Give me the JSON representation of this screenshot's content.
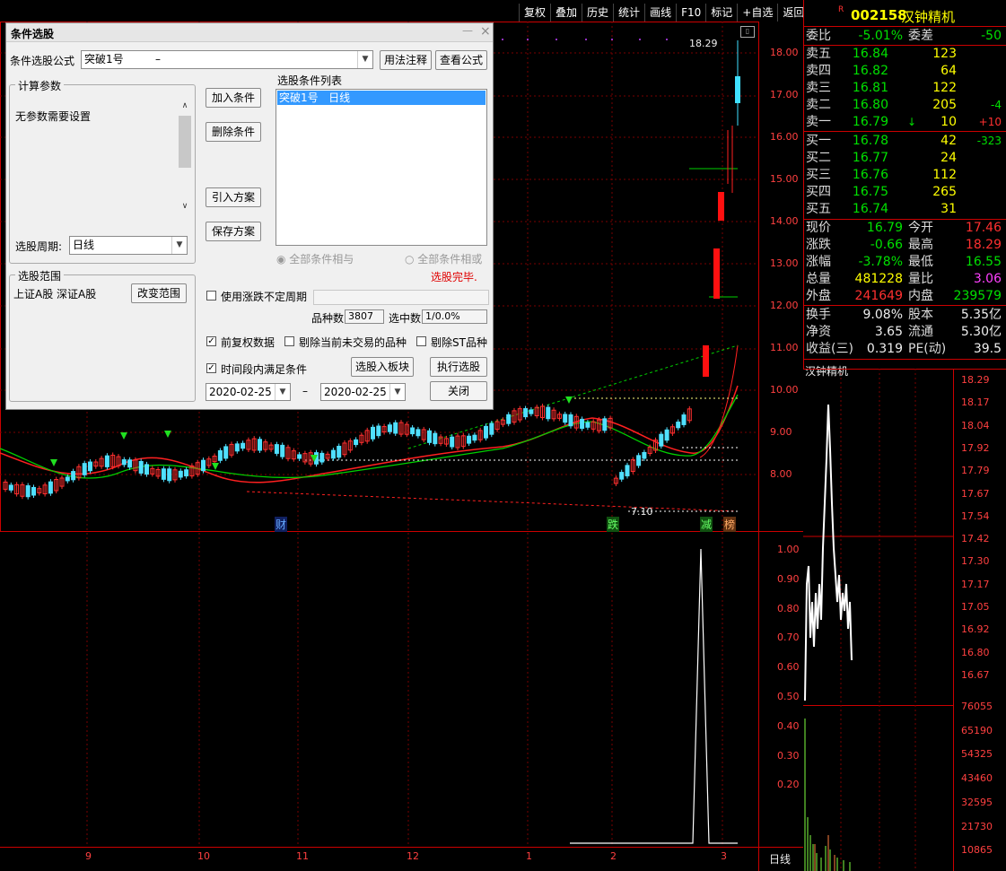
{
  "toolbar": [
    "复权",
    "叠加",
    "历史",
    "统计",
    "画线",
    "F10",
    "标记",
    "+自选",
    "返回"
  ],
  "stock": {
    "code": "002158",
    "name": "汉钟精机",
    "flag": "R"
  },
  "summary": {
    "weibi_label": "委比",
    "weibi": "-5.01%",
    "weicha_label": "委差",
    "weicha": "-50"
  },
  "asks": [
    {
      "label": "卖五",
      "price": "16.84",
      "vol": "123",
      "chg": ""
    },
    {
      "label": "卖四",
      "price": "16.82",
      "vol": "64",
      "chg": ""
    },
    {
      "label": "卖三",
      "price": "16.81",
      "vol": "122",
      "chg": ""
    },
    {
      "label": "卖二",
      "price": "16.80",
      "vol": "205",
      "chg": "-4"
    },
    {
      "label": "卖一",
      "price": "16.79",
      "vol": "10",
      "chg": "+10",
      "arrow": "↓"
    }
  ],
  "bids": [
    {
      "label": "买一",
      "price": "16.78",
      "vol": "42",
      "chg": "-323"
    },
    {
      "label": "买二",
      "price": "16.77",
      "vol": "24",
      "chg": ""
    },
    {
      "label": "买三",
      "price": "16.76",
      "vol": "112",
      "chg": ""
    },
    {
      "label": "买四",
      "price": "16.75",
      "vol": "265",
      "chg": ""
    },
    {
      "label": "买五",
      "price": "16.74",
      "vol": "31",
      "chg": ""
    }
  ],
  "stats1": [
    {
      "a": "现价",
      "b": "16.79",
      "c": "今开",
      "d": "17.46"
    },
    {
      "a": "涨跌",
      "b": "-0.66",
      "c": "最高",
      "d": "18.29"
    },
    {
      "a": "涨幅",
      "b": "-3.78%",
      "c": "最低",
      "d": "16.55"
    },
    {
      "a": "总量",
      "b": "481228",
      "c": "量比",
      "d": "3.06"
    },
    {
      "a": "外盘",
      "b": "241649",
      "c": "内盘",
      "d": "239579"
    }
  ],
  "stats2": [
    {
      "a": "换手",
      "b": "9.08%",
      "c": "股本",
      "d": "5.35亿"
    },
    {
      "a": "净资",
      "b": "3.65",
      "c": "流通",
      "d": "5.30亿"
    },
    {
      "a": "收益(三)",
      "b": "0.319",
      "c": "PE(动)",
      "d": "39.5"
    }
  ],
  "mini": {
    "title": "汉钟精机",
    "price_ticks": [
      "18.29",
      "18.17",
      "18.04",
      "17.92",
      "17.79",
      "17.67",
      "17.54",
      "17.42",
      "17.30",
      "17.17",
      "17.05",
      "16.92",
      "16.80",
      "16.67"
    ],
    "vol_ticks": [
      "76055",
      "65190",
      "54325",
      "43460",
      "32595",
      "21730",
      "10865"
    ],
    "period": "日线"
  },
  "main_chart": {
    "price_ticks": [
      "18.00",
      "17.00",
      "16.00",
      "15.00",
      "14.00",
      "13.00",
      "12.00",
      "11.00",
      "10.00",
      "9.00",
      "8.00"
    ],
    "high_label": "18.29",
    "low_label": "7.10",
    "markers": [
      {
        "t": "财"
      },
      {
        "t": "跌"
      },
      {
        "t": "减"
      },
      {
        "t": "榜"
      }
    ],
    "months": [
      "9",
      "10",
      "11",
      "12",
      "1",
      "2",
      "3"
    ]
  },
  "indicator": {
    "ticks": [
      "1.00",
      "0.90",
      "0.80",
      "0.70",
      "0.60",
      "0.50",
      "0.40",
      "0.30",
      "0.20"
    ]
  },
  "dialog": {
    "title": "条件选股",
    "formula_label": "条件选股公式",
    "formula_value": "突破1号",
    "formula_dash": "–",
    "usage_btn": "用法注释",
    "view_btn": "查看公式",
    "params_group": "计算参数",
    "params_text": "无参数需要设置",
    "period_label": "选股周期:",
    "period_value": "日线",
    "range_group": "选股范围",
    "range_text": "上证A股 深证A股",
    "change_range_btn": "改变范围",
    "add_btn": "加入条件",
    "del_btn": "删除条件",
    "import_btn": "引入方案",
    "save_btn": "保存方案",
    "cond_list_label": "选股条件列表",
    "cond_items": [
      "突破1号   日线"
    ],
    "radio_and": "全部条件相与",
    "radio_or": "全部条件相或",
    "status": "选股完毕.",
    "use_uncertain_label": "使用涨跌不定周期",
    "count_label": "品种数",
    "count_value": "3807",
    "selected_label": "选中数",
    "selected_value": "1/0.0%",
    "cb_adjust": "前复权数据",
    "cb_exclude_untraded": "剔除当前未交易的品种",
    "cb_exclude_st": "剔除ST品种",
    "cb_timerange": "时间段内满足条件",
    "to_block_btn": "选股入板块",
    "run_btn": "执行选股",
    "date_from": "2020-02-25",
    "date_sep": "–",
    "date_to": "2020-02-25",
    "close_btn": "关闭"
  }
}
